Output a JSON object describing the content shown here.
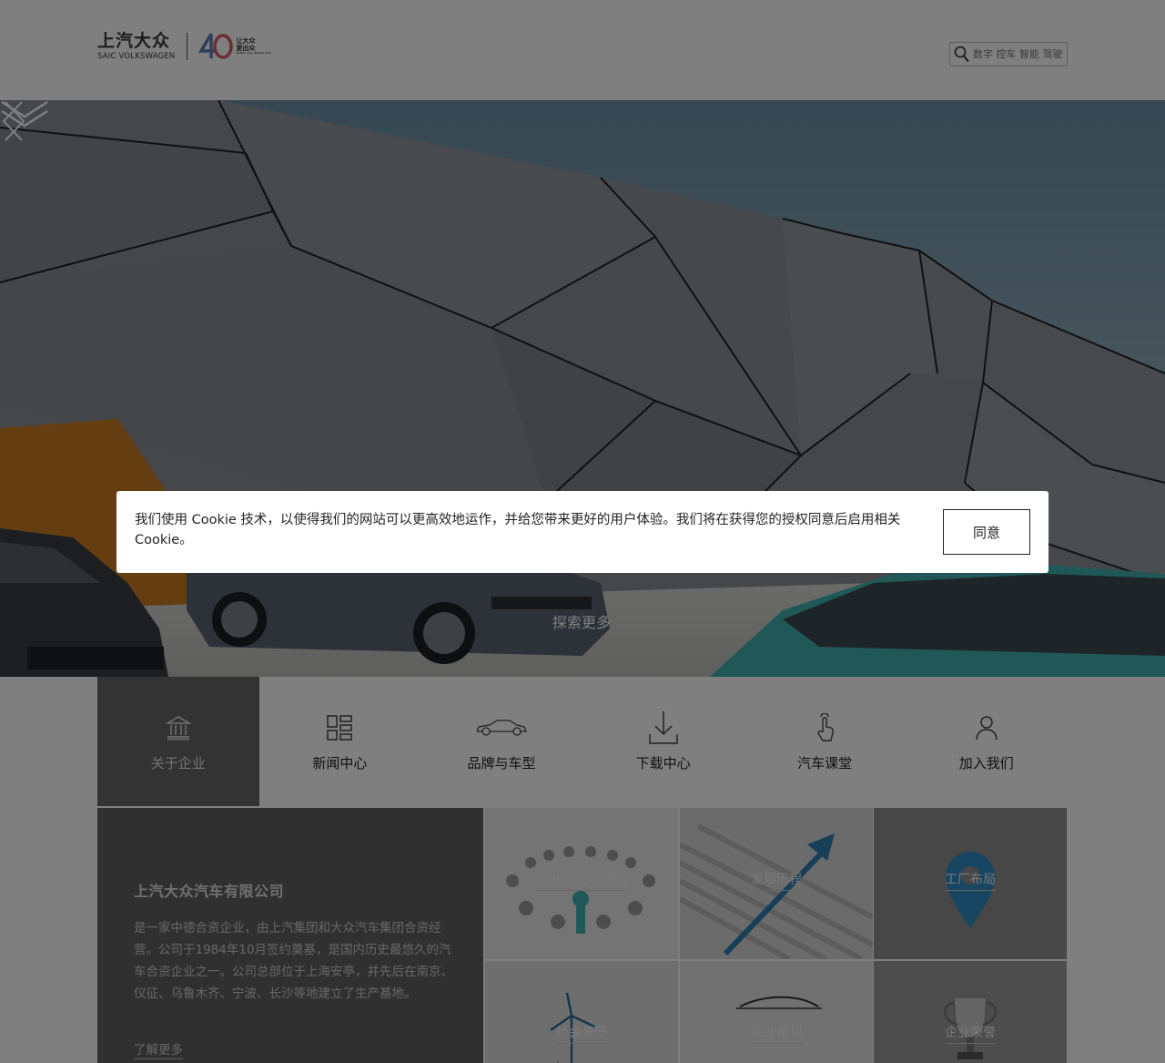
{
  "header": {
    "logo_cn": "上汽大众",
    "logo_en": "SAIC VOLKSWAGEN",
    "logo_40_slogan_line1": "让大众",
    "logo_40_slogan_line2": "更出众",
    "logo_40_slogan_en": "Better you. Better Life.",
    "search_placeholder": "数字 控车 智能 驾驶"
  },
  "hero": {
    "explore_label": "探索更多"
  },
  "cookie_banner": {
    "text": "我们使用 Cookie 技术，以使得我们的网站可以更高效地运作，并给您带来更好的用户体验。我们将在获得您的授权同意后启用相关 Cookie。",
    "agree_label": "同意"
  },
  "nav": {
    "items": [
      {
        "label": "关于企业",
        "icon": "building-icon",
        "active": true
      },
      {
        "label": "新闻中心",
        "icon": "grid-icon",
        "active": false
      },
      {
        "label": "品牌与车型",
        "icon": "car-icon",
        "active": false
      },
      {
        "label": "下载中心",
        "icon": "download-icon",
        "active": false
      },
      {
        "label": "汽车课堂",
        "icon": "touch-icon",
        "active": false
      },
      {
        "label": "加入我们",
        "icon": "person-icon",
        "active": false
      }
    ]
  },
  "about": {
    "title": "上汽大众汽车有限公司",
    "description": "是一家中德合资企业，由上汽集团和大众汽车集团合资经营。公司于1984年10月签约奠基，是国内历史最悠久的汽车合资企业之一。公司总部位于上海安亭，并先后在南京、仪征、乌鲁木齐、宁波、长沙等地建立了生产基地。",
    "more_label": "了解更多"
  },
  "tiles": [
    {
      "label": "企业文化与战略"
    },
    {
      "label": "发展历程"
    },
    {
      "label": "工厂布局"
    },
    {
      "label": "社会责任"
    },
    {
      "label": "企业年刊"
    },
    {
      "label": "企业荣誉"
    }
  ],
  "colors": {
    "overlay": "rgba(0,0,0,0.5)",
    "active_nav_bg": "#666666",
    "about_bg": "#616161",
    "sky": "#6f8fa3",
    "teal_car": "#3fb1ad"
  }
}
